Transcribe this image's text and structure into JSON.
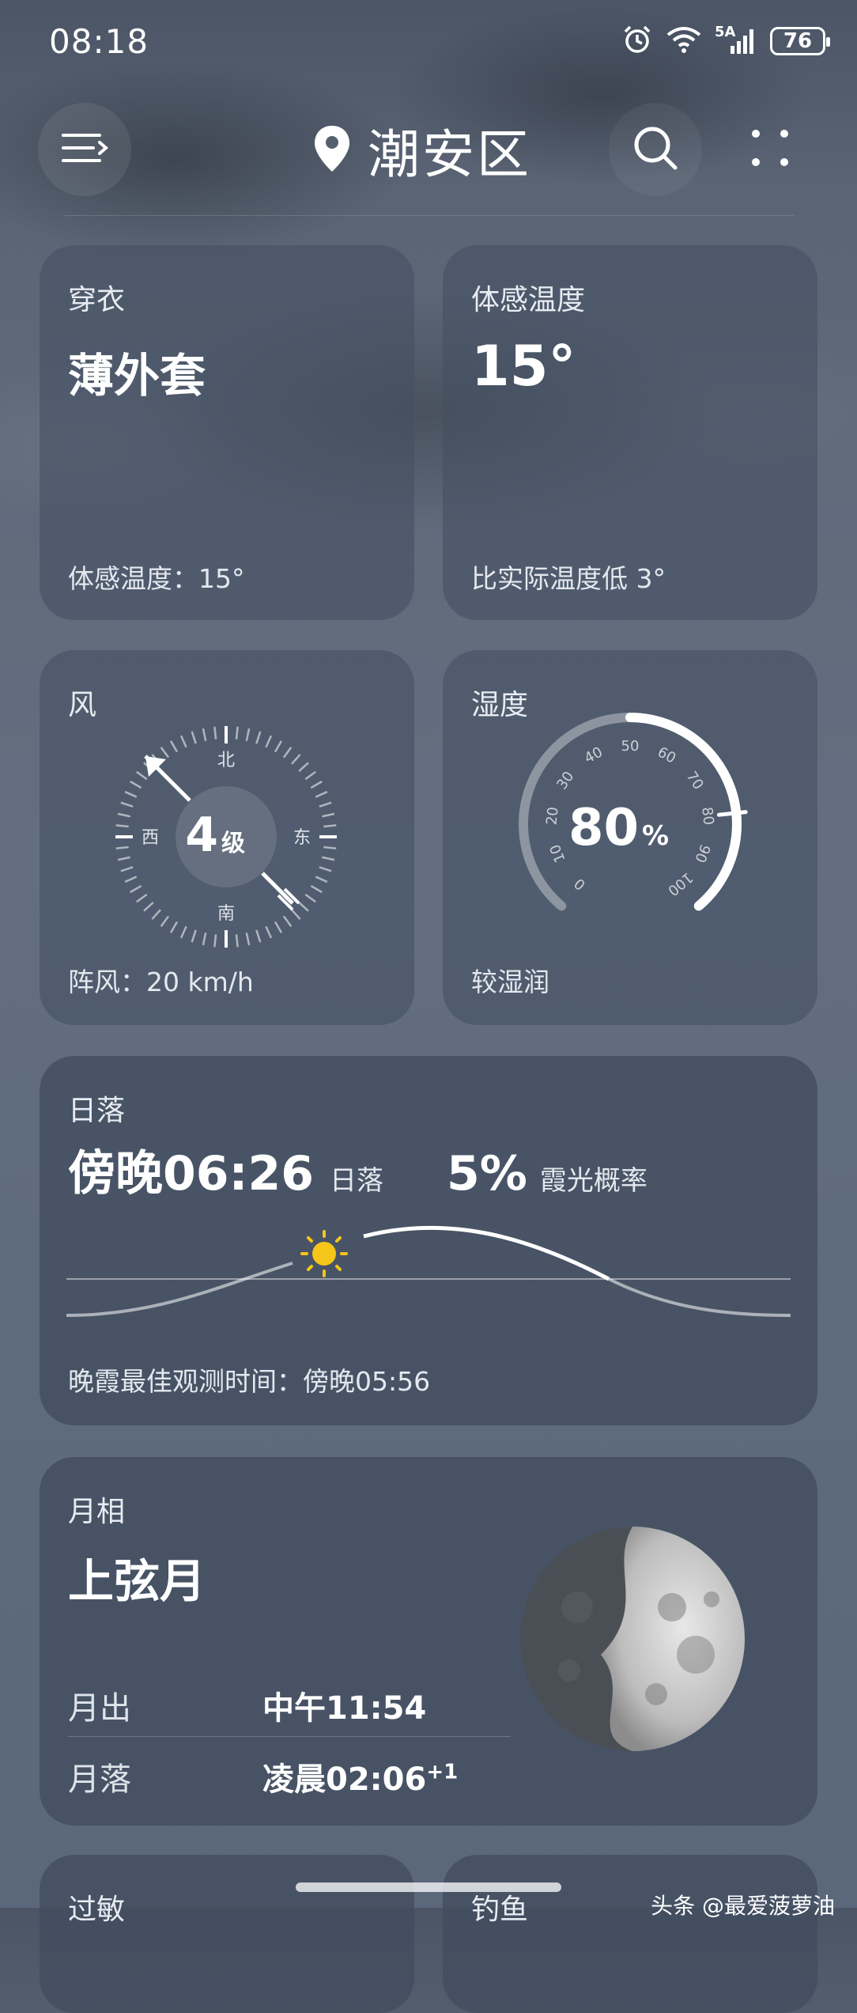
{
  "status_bar": {
    "time": "08:18",
    "network": "5A",
    "battery": "76"
  },
  "header": {
    "location": "潮安区"
  },
  "clothing": {
    "title": "穿衣",
    "value": "薄外套",
    "footer": "体感温度：15°"
  },
  "feels_like": {
    "title": "体感温度",
    "value": "15°",
    "footer": "比实际温度低 3°"
  },
  "wind": {
    "title": "风",
    "level_number": "4",
    "level_unit": "级",
    "dir_north": "北",
    "dir_south": "南",
    "dir_east": "东",
    "dir_west": "西",
    "footer": "阵风：20 km/h"
  },
  "humidity": {
    "title": "湿度",
    "value_number": "80",
    "value_unit": "%",
    "percent": 80,
    "ticks": [
      "0",
      "10",
      "20",
      "30",
      "40",
      "50",
      "60",
      "70",
      "80",
      "90",
      "100"
    ],
    "footer": "较湿润"
  },
  "sunset": {
    "title": "日落",
    "time": "傍晚06:26",
    "time_label": "日落",
    "glow_prob": "5%",
    "glow_label": "霞光概率",
    "footer": "晚霞最佳观测时间：傍晚05:56"
  },
  "moon": {
    "title": "月相",
    "phase": "上弦月",
    "rise_label": "月出",
    "rise_value": "中午11:54",
    "set_label": "月落",
    "set_value": "凌晨02:06",
    "set_sup": "+1"
  },
  "bottom_cards": {
    "left_title": "过敏",
    "right_title": "钓鱼"
  },
  "watermark": "头条 @最爱菠萝油",
  "colors": {
    "sun": "#f5c518",
    "accent_white": "#ffffff"
  }
}
